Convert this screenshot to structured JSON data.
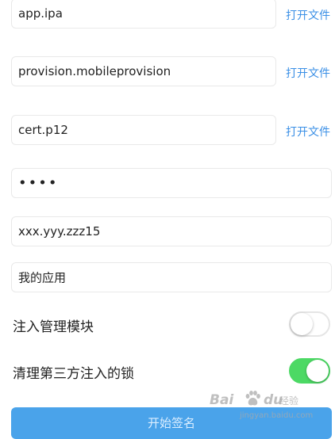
{
  "files": {
    "ipa": {
      "value": "app.ipa",
      "button": "打开文件"
    },
    "provision": {
      "value": "provision.mobileprovision",
      "button": "打开文件"
    },
    "cert": {
      "value": "cert.p12",
      "button": "打开文件"
    }
  },
  "password": {
    "value": "••••"
  },
  "bundle_id": {
    "value": "xxx.yyy.zzz15"
  },
  "app_name": {
    "value": "我的应用"
  },
  "options": {
    "inject_module": {
      "label": "注入管理模块",
      "enabled": false
    },
    "clear_lock": {
      "label": "清理第三方注入的锁",
      "enabled": true
    }
  },
  "submit": {
    "label": "开始签名"
  },
  "watermark": {
    "brand": "Bai",
    "brand2": "du",
    "sub": "经验",
    "url": "jingyan.baidu.com"
  },
  "colors": {
    "accent": "#3a8fe6",
    "toggle_on": "#4cd964",
    "button": "#4aa3ea"
  }
}
